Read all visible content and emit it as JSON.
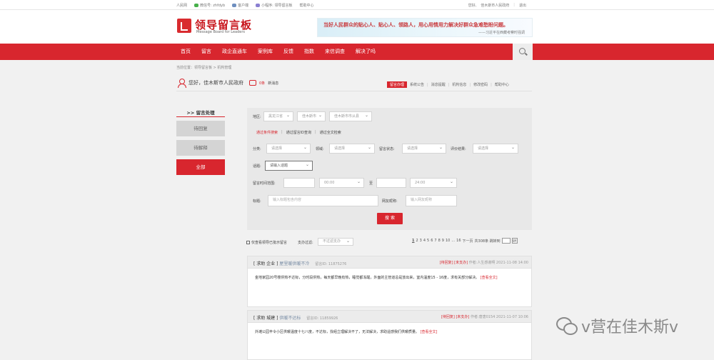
{
  "topbar": {
    "site": "人民网",
    "weibo": "微信号: zhfdyb",
    "client": "客户端",
    "miniapp": "小程序: 领导留言板",
    "help": "帮助中心",
    "hello": "您好,",
    "user": "佳木斯市人民政府",
    "logout": "退出"
  },
  "header": {
    "logo_cn": "领导留言板",
    "logo_en": "Message Board for Leaders",
    "banner_main": "当好人民群众的贴心人、贴心人、领路人，用心用情用力解决好群众急难愁盼问题。",
    "banner_sub": "——习近平在西藏考察时强调"
  },
  "nav": {
    "items": [
      "首页",
      "留言",
      "政企直通车",
      "案例库",
      "反馈",
      "指数",
      "来信调查",
      "解决了吗"
    ]
  },
  "breadcrumb": "当前位置：领导留言板 > 机构管理",
  "welcome": {
    "greeting": "您好，佳木斯市人民政府",
    "msg_count": "0条",
    "msg_new": "新消息"
  },
  "toplinks": [
    "留言办理",
    "系统公告",
    "消息提醒",
    "机构信息",
    "修改密码",
    "帮助中心"
  ],
  "sidebar": {
    "title": ">> 留言处理",
    "items": [
      "待回复",
      "待解释",
      "全部"
    ]
  },
  "filter": {
    "region_label": "地区:",
    "region": [
      "黑龙江省",
      "佳木斯市",
      "佳木斯市市从县"
    ],
    "tabs": [
      "通过条件搜索",
      "通过留言ID查询",
      "通过全文检索"
    ],
    "category_label": "分类:",
    "category": "请选择",
    "field_label": "领域:",
    "field": "请选择",
    "state_label": "留言状态:",
    "state": "请选择",
    "eval_label": "评价结果:",
    "eval": "请选择",
    "topic_label": "话题:",
    "topic": "请输入话题",
    "time_label": "留言时间范围:",
    "time_from_hour": "00:00",
    "to": "至",
    "time_to_hour": "24:00",
    "title_label": "标题:",
    "title_placeholder": "输入标题包含内容",
    "user_label": "网友昵称:",
    "user_placeholder": "输入网友昵称",
    "search": "搜 索"
  },
  "listbar": {
    "only_label": "仅查看领导已批示留言",
    "pay_label": "支办过滤:",
    "pay_value": "不过滤支办",
    "pages": [
      "1",
      "2",
      "3",
      "4",
      "5",
      "6",
      "7",
      "8",
      "9",
      "10",
      "...",
      "16",
      "下一页"
    ],
    "total": "共308条 跳转到",
    "go": "go"
  },
  "cards": [
    {
      "type": "[ 求助",
      "domain": "企业 ]",
      "subject": "屋里暖供暖不冷",
      "id": "留言ID: 11875276",
      "tag1": "[待回复]",
      "tag2": "[未支办]",
      "author": "作者:人生感谢啊 2021-11-08 14:00",
      "body": "金地家园20号楼供热不达标，分时段供热，每天都早晚有热，睡觉都冻醒，外面的主管道总是放出来，室内温度15 - 16度，求有关部分解决。",
      "more": "[查看全文]"
    },
    {
      "type": "[ 求助",
      "domain": "城建 ]",
      "subject": "供暖不达标",
      "id": "留言ID: 11859926",
      "tag1": "[待回复]",
      "tag2": "[未支办]",
      "author": "作者:唐唐0154 2021-11-07 10:06",
      "body": "外滩公园丰令小区供暖温度十七八度，不达标，找组立理解决不了，无法解决，求助遥感我们供暖质量。",
      "more": "[查看全文]"
    }
  ],
  "watermark": "v营在佳木斯v"
}
